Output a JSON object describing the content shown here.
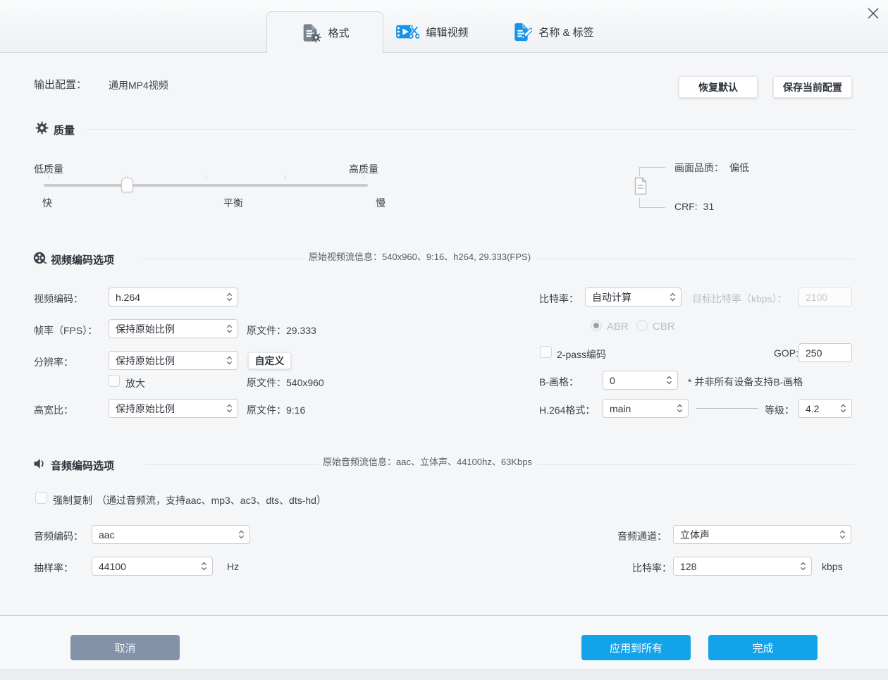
{
  "window": {
    "bg_color": "#f5f6f7",
    "accent_color": "#12a3ea",
    "cancel_color": "#8292a9",
    "close_icon": "close-x-icon"
  },
  "tabs": {
    "format": {
      "label": "格式",
      "active": true,
      "icon": "document-gear-icon"
    },
    "edit": {
      "label": "编辑视频",
      "active": false,
      "icon": "video-scissors-icon"
    },
    "name": {
      "label": "名称 & 标签",
      "active": false,
      "icon": "document-pencil-icon"
    }
  },
  "header": {
    "output_label": "输出配置：",
    "output_value": "通用MP4视频",
    "restore_default": "恢复默认",
    "save_config": "保存当前配置"
  },
  "quality": {
    "title": "质量",
    "icon": "gear-icon",
    "slider": {
      "low": "低质量",
      "high": "高质量",
      "fast": "快",
      "balanced": "平衡",
      "slow": "慢",
      "ticks": 5,
      "position_percent": 26
    },
    "result": {
      "picture_label": "画面品质：",
      "picture_value": "偏低",
      "crf_label": "CRF:",
      "crf_value": "31",
      "icon": "document-outline-icon"
    }
  },
  "video": {
    "title": "视频编码选项",
    "icon": "film-reel-icon",
    "stream_info": "原始视频流信息：540x960、9:16、h264, 29.333(FPS)",
    "codec": {
      "label": "视频编码：",
      "value": "h.264"
    },
    "fps": {
      "label": "帧率（FPS）：",
      "value": "保持原始比例",
      "original": "原文件：29.333"
    },
    "resolution": {
      "label": "分辨率：",
      "value": "保持原始比例",
      "custom": "自定义",
      "upscale": "放大",
      "upscale_checked": false,
      "original": "原文件：540x960"
    },
    "aspect": {
      "label": "高宽比：",
      "value": "保持原始比例",
      "original": "原文件：9:16"
    },
    "bitrate": {
      "label": "比特率：",
      "value": "自动计算",
      "target_label": "目标比特率（kbps）：",
      "target_value": "2100",
      "target_enabled": false
    },
    "mode": {
      "abr": "ABR",
      "cbr": "CBR",
      "selected": "ABR",
      "enabled": false
    },
    "two_pass": {
      "label": "2-pass编码",
      "checked": false
    },
    "gop": {
      "label": "GOP:",
      "value": "250"
    },
    "bframe": {
      "label": "B-画格：",
      "value": "0",
      "note": "* 并非所有设备支持B-画格"
    },
    "profile": {
      "label": "H.264格式：",
      "value": "main",
      "level_label": "等级：",
      "level_value": "4.2"
    }
  },
  "audio": {
    "title": "音频编码选项",
    "icon": "speaker-icon",
    "stream_info": "原始音频流信息：aac、立体声、44100hz、63Kbps",
    "force_copy": {
      "label": "强制复制",
      "note": "（通过音频流，支持aac、mp3、ac3、dts、dts-hd）",
      "checked": false
    },
    "codec": {
      "label": "音频编码：",
      "value": "aac"
    },
    "channel": {
      "label": "音频通道：",
      "value": "立体声"
    },
    "sample_rate": {
      "label": "抽样率：",
      "value": "44100",
      "unit": "Hz"
    },
    "bitrate": {
      "label": "比特率：",
      "value": "128",
      "unit": "kbps"
    }
  },
  "footer": {
    "cancel": "取消",
    "apply_all": "应用到所有",
    "done": "完成"
  }
}
